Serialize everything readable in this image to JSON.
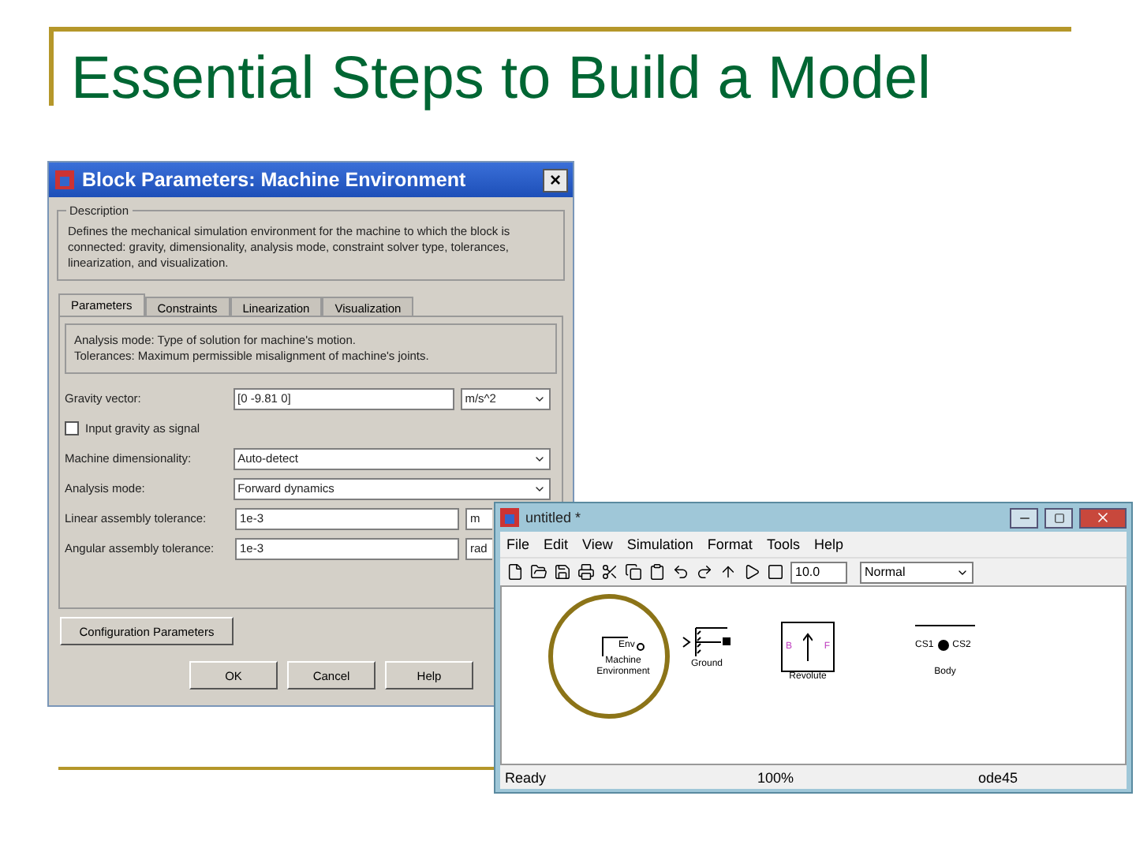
{
  "slide": {
    "title": "Essential Steps to Build a Model"
  },
  "dialog": {
    "title": "Block Parameters: Machine Environment",
    "close": "×",
    "description_legend": "Description",
    "description": "Defines the mechanical simulation environment for the machine to which the block is connected: gravity, dimensionality, analysis mode, constraint solver type, tolerances, linearization, and visualization.",
    "tabs": [
      {
        "label": "Parameters",
        "selected": true
      },
      {
        "label": "Constraints",
        "selected": false
      },
      {
        "label": "Linearization",
        "selected": false
      },
      {
        "label": "Visualization",
        "selected": false
      }
    ],
    "help_lines": [
      "Analysis mode: Type of solution for machine's motion.",
      "Tolerances: Maximum permissible misalignment of machine's joints."
    ],
    "rows": [
      {
        "kind": "field",
        "label": "Gravity vector:",
        "value": "[0 -9.81 0]",
        "unit": "m/s^2"
      },
      {
        "kind": "checkbox",
        "label": "Input gravity as signal",
        "checked": false
      },
      {
        "kind": "select",
        "label": "Machine dimensionality:",
        "value": "Auto-detect"
      },
      {
        "kind": "select",
        "label": "Analysis mode:",
        "value": "Forward dynamics"
      },
      {
        "kind": "field",
        "label": "Linear assembly tolerance:",
        "value": "1e-3",
        "unit": "m"
      },
      {
        "kind": "field",
        "label": "Angular assembly tolerance:",
        "value": "1e-3",
        "unit": "rad"
      }
    ],
    "config_button": "Configuration Parameters",
    "buttons": [
      "OK",
      "Cancel",
      "Help"
    ]
  },
  "model": {
    "title": "untitled *",
    "menu": [
      "File",
      "Edit",
      "View",
      "Simulation",
      "Format",
      "Tools",
      "Help"
    ],
    "stop_time": "10.0",
    "mode": "Normal",
    "blocks": [
      {
        "kind": "env",
        "port": "Env",
        "label": "Machine Environment"
      },
      {
        "kind": "ground",
        "label": "Ground"
      },
      {
        "kind": "revolute",
        "left": "B",
        "right": "F",
        "label": "Revolute"
      },
      {
        "kind": "body",
        "left": "CS1",
        "right": "CS2",
        "label": "Body"
      }
    ],
    "status": [
      "Ready",
      "100%",
      "ode45"
    ]
  }
}
